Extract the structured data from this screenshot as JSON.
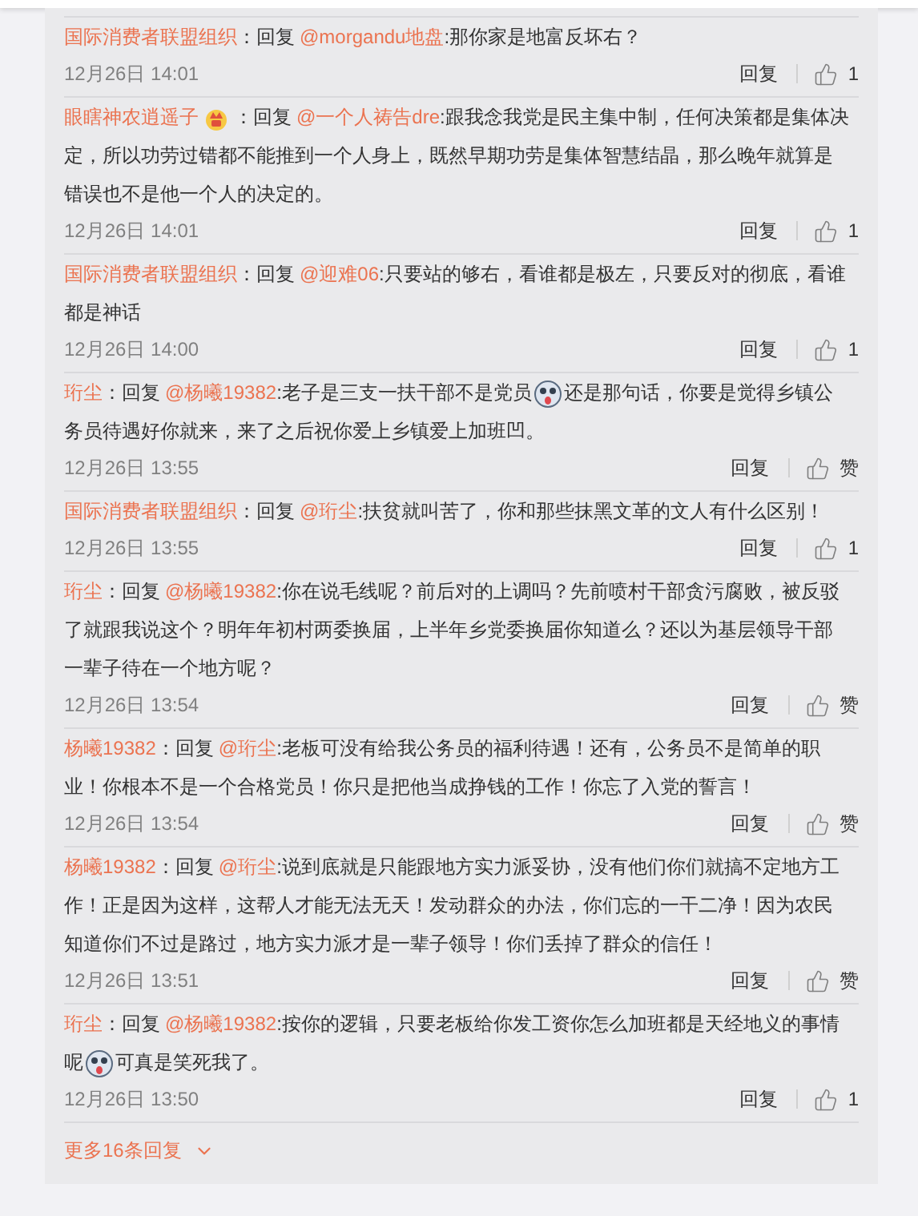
{
  "comments": [
    {
      "user": "国际消费者联盟组织",
      "badge": false,
      "separator": "：",
      "reply_label": "回复",
      "mention": "@morgandu地盘",
      "body": [
        {
          "kind": "text",
          "text": ":那你家是地富反坏右？"
        }
      ],
      "date": "12月26日 14:01",
      "reply_button": "回复",
      "likes": "1"
    },
    {
      "user": "眼瞎神农逍遥子",
      "badge": true,
      "separator": "：",
      "reply_label": "回复",
      "mention": "@一个人祷告dre",
      "body": [
        {
          "kind": "text",
          "text": ":跟我念我党是民主集中制，任何决策都是集体决定，所以功劳过错都不能推到一个人身上，既然早期功劳是集体智慧结晶，那么晚年就算是错误也不是他一个人的决定的。"
        }
      ],
      "date": "12月26日 14:01",
      "reply_button": "回复",
      "likes": "1"
    },
    {
      "user": "国际消费者联盟组织",
      "badge": false,
      "separator": "：",
      "reply_label": "回复",
      "mention": "@迎难06",
      "body": [
        {
          "kind": "text",
          "text": ":只要站的够右，看谁都是极左，只要反对的彻底，看谁都是神话"
        }
      ],
      "date": "12月26日 14:00",
      "reply_button": "回复",
      "likes": "1"
    },
    {
      "user": "珩尘",
      "badge": false,
      "separator": "：",
      "reply_label": "回复",
      "mention": "@杨曦19382",
      "body": [
        {
          "kind": "text",
          "text": ":老子是三支一扶干部不是党员"
        },
        {
          "kind": "emoji"
        },
        {
          "kind": "text",
          "text": "还是那句话，你要是觉得乡镇公务员待遇好你就来，来了之后祝你爱上乡镇爱上加班凹。"
        }
      ],
      "date": "12月26日 13:55",
      "reply_button": "回复",
      "likes": "赞"
    },
    {
      "user": "国际消费者联盟组织",
      "badge": false,
      "separator": "：",
      "reply_label": "回复",
      "mention": "@珩尘",
      "body": [
        {
          "kind": "text",
          "text": ":扶贫就叫苦了，你和那些抹黑文革的文人有什么区别！"
        }
      ],
      "date": "12月26日 13:55",
      "reply_button": "回复",
      "likes": "1"
    },
    {
      "user": "珩尘",
      "badge": false,
      "separator": "：",
      "reply_label": "回复",
      "mention": "@杨曦19382",
      "body": [
        {
          "kind": "text",
          "text": ":你在说毛线呢？前后对的上调吗？先前喷村干部贪污腐败，被反驳了就跟我说这个？明年年初村两委换届，上半年乡党委换届你知道么？还以为基层领导干部一辈子待在一个地方呢？"
        }
      ],
      "date": "12月26日 13:54",
      "reply_button": "回复",
      "likes": "赞"
    },
    {
      "user": "杨曦19382",
      "badge": false,
      "separator": "：",
      "reply_label": "回复",
      "mention": "@珩尘",
      "body": [
        {
          "kind": "text",
          "text": ":老板可没有给我公务员的福利待遇！还有，公务员不是简单的职业！你根本不是一个合格党员！你只是把他当成挣钱的工作！你忘了入党的誓言！"
        }
      ],
      "date": "12月26日 13:54",
      "reply_button": "回复",
      "likes": "赞"
    },
    {
      "user": "杨曦19382",
      "badge": false,
      "separator": "：",
      "reply_label": "回复",
      "mention": "@珩尘",
      "body": [
        {
          "kind": "text",
          "text": ":说到底就是只能跟地方实力派妥协，没有他们你们就搞不定地方工作！正是因为这样，这帮人才能无法无天！发动群众的办法，你们忘的一干二净！因为农民知道你们不过是路过，地方实力派才是一辈子领导！你们丢掉了群众的信任！"
        }
      ],
      "date": "12月26日 13:51",
      "reply_button": "回复",
      "likes": "赞"
    },
    {
      "user": "珩尘",
      "badge": false,
      "separator": "：",
      "reply_label": "回复",
      "mention": "@杨曦19382",
      "body": [
        {
          "kind": "text",
          "text": ":按你的逻辑，只要老板给你发工资你怎么加班都是天经地义的事情呢"
        },
        {
          "kind": "emoji"
        },
        {
          "kind": "text",
          "text": "可真是笑死我了。"
        }
      ],
      "date": "12月26日 13:50",
      "reply_button": "回复",
      "likes": "1"
    }
  ],
  "more": {
    "label": "更多16条回复"
  }
}
